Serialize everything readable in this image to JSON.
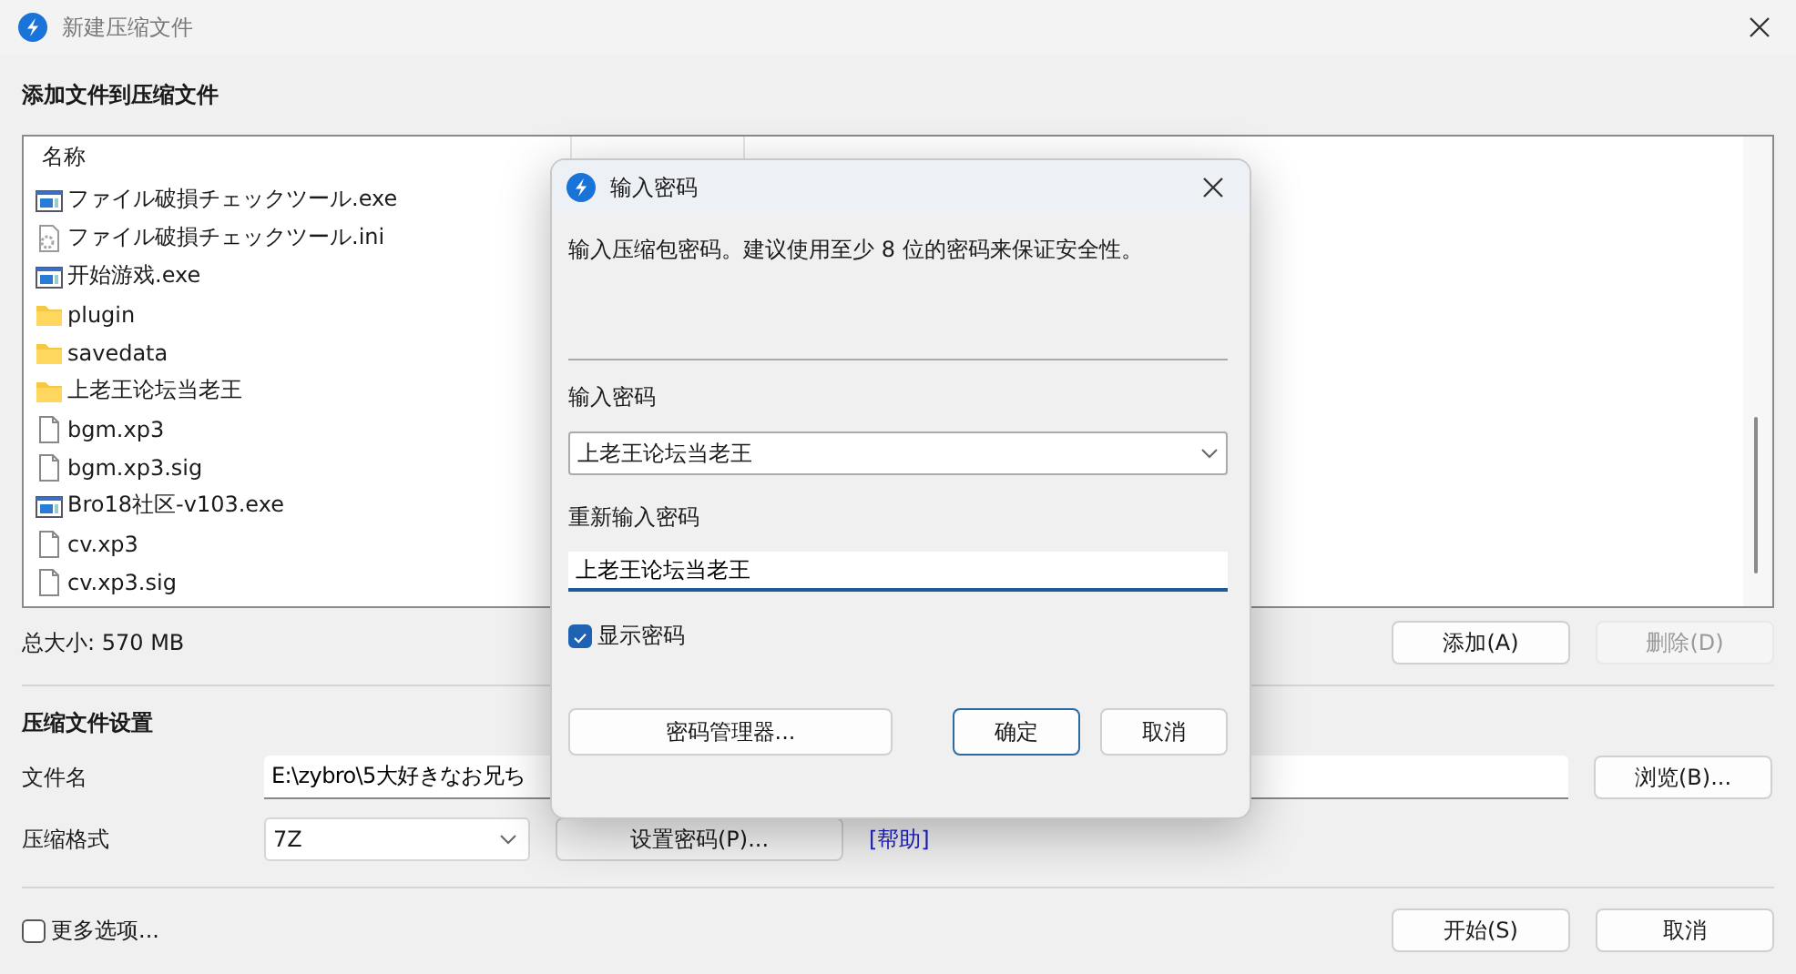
{
  "window": {
    "title": "新建压缩文件"
  },
  "files": {
    "heading": "添加文件到压缩文件",
    "columns": [
      {
        "label": "名称"
      }
    ],
    "rows": [
      {
        "name": "ファイル破損チェックツール.exe",
        "kind": "exe"
      },
      {
        "name": "ファイル破損チェックツール.ini",
        "kind": "config"
      },
      {
        "name": "开始游戏.exe",
        "kind": "exe"
      },
      {
        "name": "plugin",
        "kind": "folder"
      },
      {
        "name": "savedata",
        "kind": "folder"
      },
      {
        "name": "上老王论坛当老王",
        "kind": "folder"
      },
      {
        "name": "bgm.xp3",
        "kind": "file"
      },
      {
        "name": "bgm.xp3.sig",
        "kind": "file"
      },
      {
        "name": "Bro18社区-v103.exe",
        "kind": "exe"
      },
      {
        "name": "cv.xp3",
        "kind": "file"
      },
      {
        "name": "cv.xp3.sig",
        "kind": "file"
      }
    ],
    "total": "总大小: 570 MB",
    "buttons": [
      {
        "label": "添加(A)",
        "disabled": false
      },
      {
        "label": "删除(D)",
        "disabled": true
      }
    ]
  },
  "settings": {
    "heading": "压缩文件设置",
    "filename_label": "文件名",
    "filename": "E:\\zybro\\5大好きなお兄ち",
    "browse_button": "浏览(B)...",
    "format_label": "压缩格式",
    "format": "7Z",
    "password_button": "设置密码(P)...",
    "help_link": "[帮助]"
  },
  "more_options": {
    "label": "更多选项...",
    "checked": false
  },
  "buttons": [
    {
      "label": "开始(S)"
    },
    {
      "label": "取消"
    }
  ],
  "password_dialog": {
    "title": "输入密码",
    "message": "输入压缩包密码。建议使用至少 8 位的密码来保证安全性。",
    "password_label": "输入密码",
    "password": "上老王论坛当老王",
    "confirm_label": "重新输入密码",
    "confirm": "上老王论坛当老王",
    "show_password": {
      "label": "显示密码",
      "checked": true
    },
    "buttons": [
      {
        "label": "密码管理器...",
        "default": false
      },
      {
        "label": "确定",
        "default": true
      },
      {
        "label": "取消",
        "default": false
      }
    ]
  }
}
